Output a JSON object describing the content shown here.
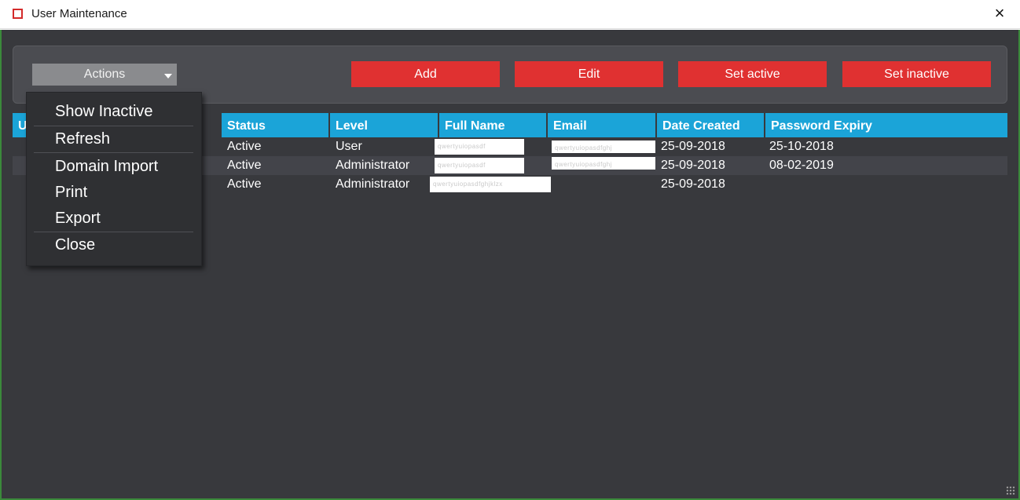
{
  "window": {
    "title": "User Maintenance",
    "close_glyph": "×"
  },
  "toolbar": {
    "actions_label": "Actions",
    "buttons": {
      "add": "Add",
      "edit": "Edit",
      "set_active": "Set active",
      "set_inactive": "Set inactive"
    }
  },
  "menu": {
    "items": [
      "Show Inactive",
      "Refresh",
      "Domain Import",
      "Print",
      "Export",
      "Close"
    ]
  },
  "grid": {
    "columns": [
      "U",
      "Status",
      "Level",
      "Full Name",
      "Email",
      "Date Created",
      "Password Expiry"
    ],
    "rows": [
      {
        "status": "Active",
        "level": "User",
        "date_created": "25-09-2018",
        "password_expiry": "25-10-2018"
      },
      {
        "status": "Active",
        "level": "Administrator",
        "date_created": "25-09-2018",
        "password_expiry": "08-02-2019"
      },
      {
        "status": "Active",
        "level": "Administrator",
        "date_created": "25-09-2018",
        "password_expiry": ""
      }
    ]
  },
  "colors": {
    "toolbar_button": "#e03131",
    "header": "#1ba4d8",
    "background": "#38393d",
    "window_border": "#3b8a3b"
  },
  "icons": [
    "app-icon",
    "close-icon",
    "chevron-down-icon",
    "resize-grip-icon"
  ]
}
